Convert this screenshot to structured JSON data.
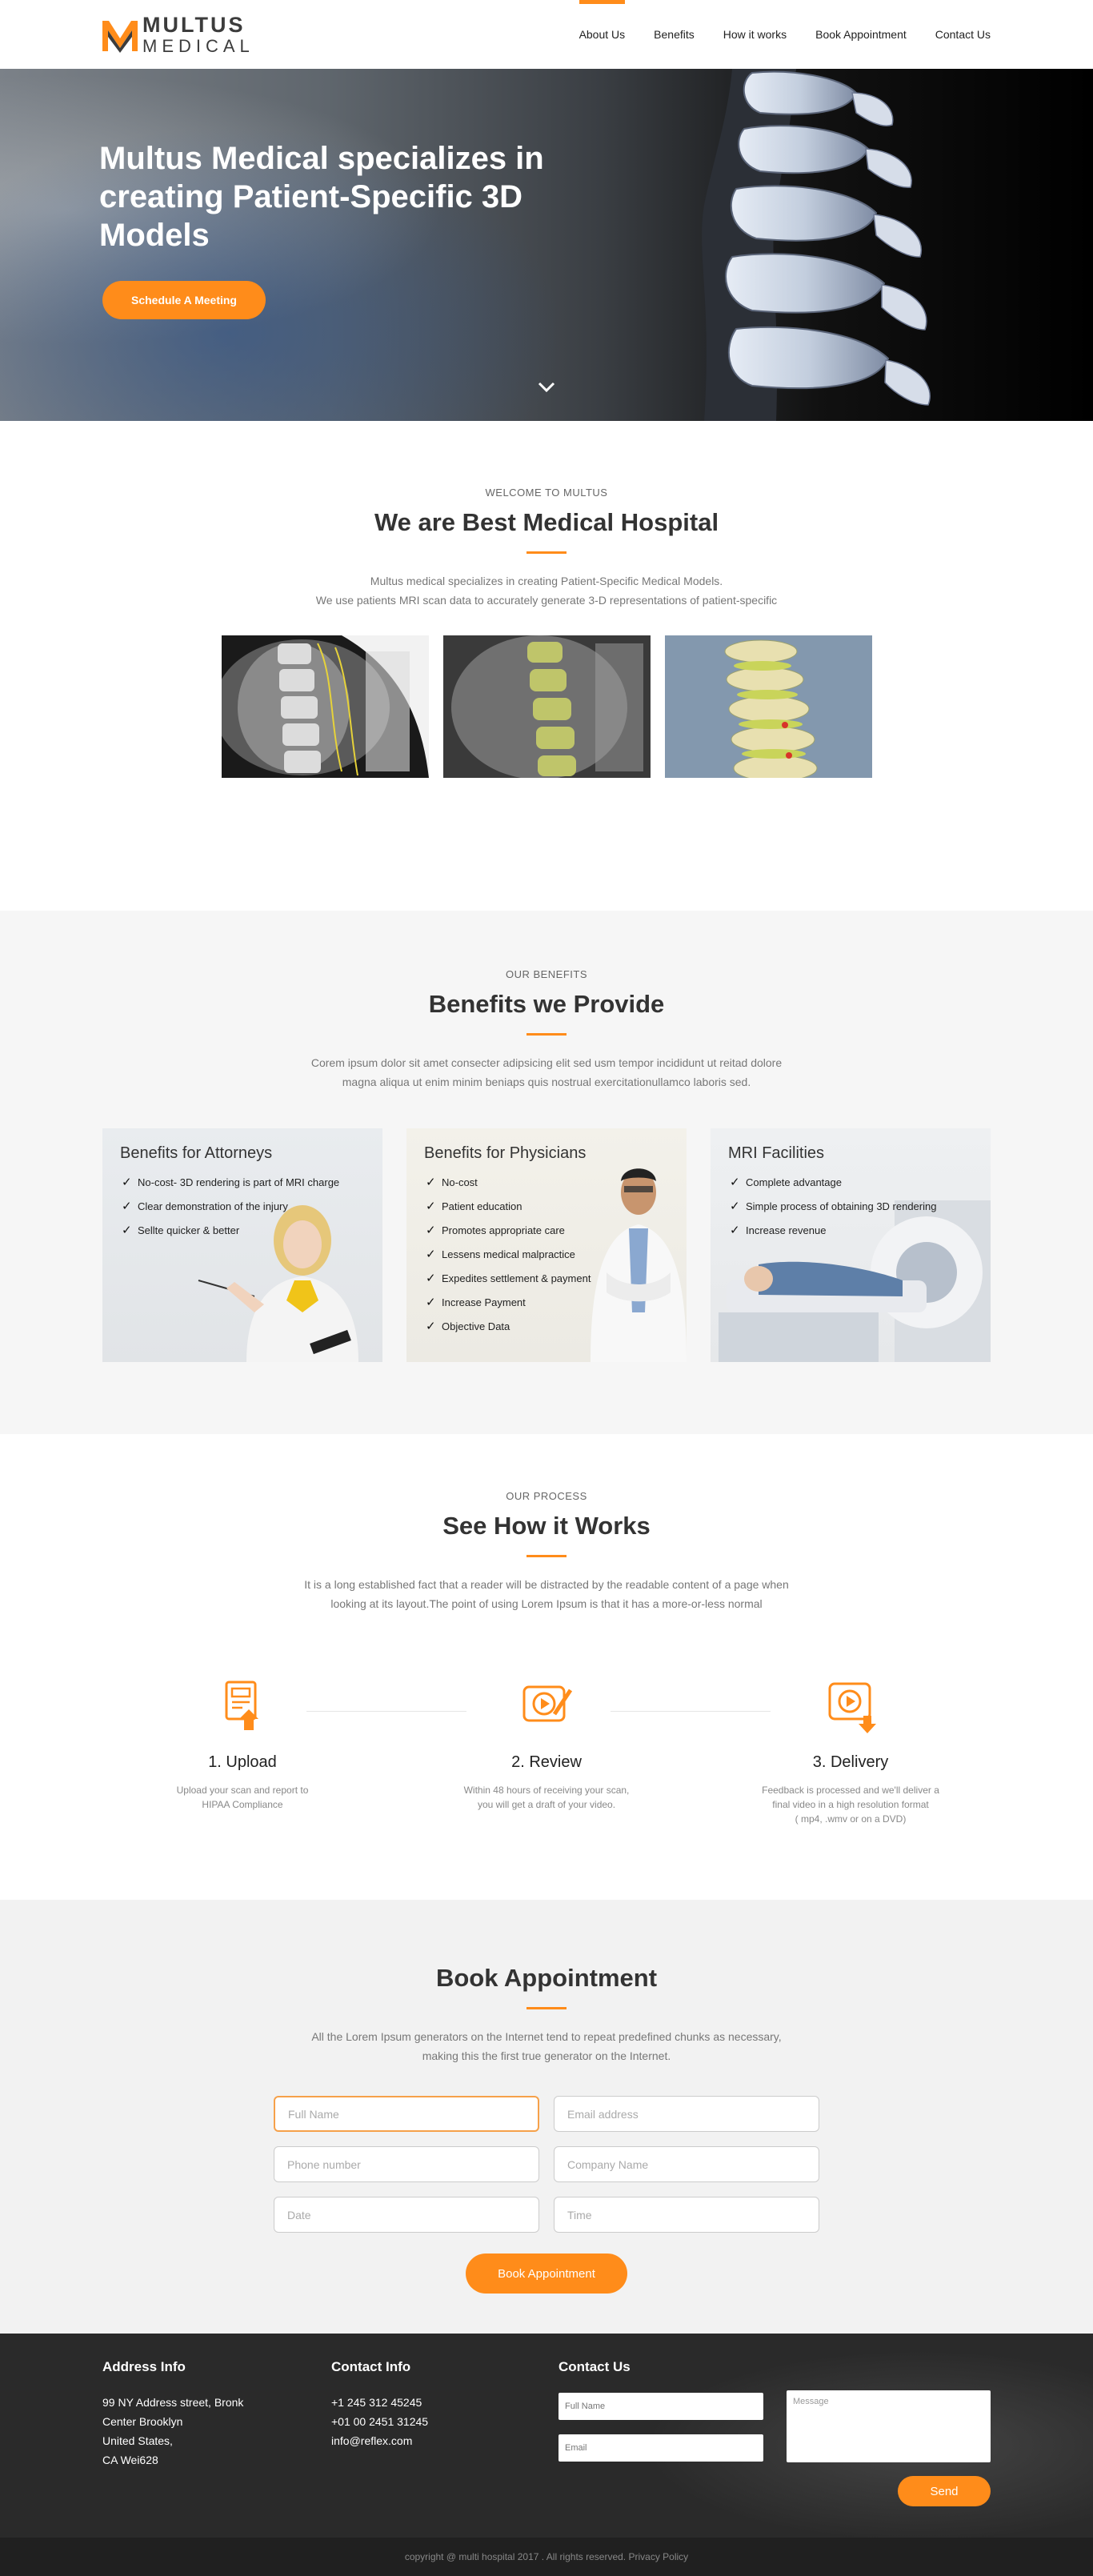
{
  "header": {
    "logo_line1": "MULTUS",
    "logo_line2": "MEDICAL",
    "nav": [
      "About Us",
      "Benefits",
      "How it works",
      "Book Appointment",
      "Contact Us"
    ]
  },
  "hero": {
    "title_bold": "Multus Medical",
    "title_rest": " specializes in creating Patient-Specific 3D Models",
    "button": "Schedule A Meeting"
  },
  "welcome": {
    "eyebrow": "WELCOME TO MULTUS",
    "title": "We are Best Medical Hospital",
    "text1": "Multus medical specializes in creating Patient-Specific Medical Models.",
    "text2": "We use patients MRI scan data to accurately generate 3-D representations of patient-specific"
  },
  "benefits": {
    "eyebrow": "OUR BENEFITS",
    "title": "Benefits we Provide",
    "text1": "Corem ipsum dolor sit amet consecter adipsicing elit sed usm tempor incididunt ut reitad dolore",
    "text2": "magna aliqua ut enim minim beniaps quis nostrual exercitationullamco laboris sed.",
    "cards": [
      {
        "title": "Benefits for Attorneys",
        "items": [
          "No-cost- 3D rendering is part of MRI charge",
          "Clear demonstration of the injury",
          "Sellte quicker & better"
        ]
      },
      {
        "title": "Benefits for Physicians",
        "items": [
          "No-cost",
          "Patient education",
          "Promotes appropriate care",
          "Lessens medical malpractice",
          "Expedites settlement & payment",
          "Increase Payment",
          "Objective Data"
        ]
      },
      {
        "title": "MRI Facilities",
        "items": [
          "Complete advantage",
          "Simple process of obtaining 3D rendering",
          "Increase revenue"
        ]
      }
    ]
  },
  "process": {
    "eyebrow": "OUR PROCESS",
    "title": "See How it Works",
    "text1": "It is a long established fact that a reader will be distracted by the readable content of a page when",
    "text2": "looking at its layout.The point of using Lorem Ipsum is that it has a more-or-less normal",
    "steps": [
      {
        "title": "1. Upload",
        "l1": "Upload your scan and report to",
        "l2": "HIPAA Compliance",
        "l3": ""
      },
      {
        "title": "2. Review",
        "l1": "Within 48 hours of receiving your scan,",
        "l2": "you will get a draft of your video.",
        "l3": ""
      },
      {
        "title": "3. Delivery",
        "l1": "Feedback is processed and we'll deliver a",
        "l2": "final video in a high resolution format",
        "l3": "( mp4, .wmv or on a DVD)"
      }
    ]
  },
  "booking": {
    "title": "Book Appointment",
    "text1": "All the Lorem Ipsum generators on the Internet tend to repeat predefined chunks as necessary,",
    "text2": "making this the first true generator on the Internet.",
    "placeholders": {
      "full_name": "Full Name",
      "email": "Email address",
      "phone": "Phone number",
      "company": "Company Name",
      "date": "Date",
      "time": "Time"
    },
    "button": "Book Appointment"
  },
  "footer": {
    "address_title": "Address Info",
    "address": [
      "99 NY Address street, Bronk",
      "Center Brooklyn",
      "United States,",
      "CA Wei628"
    ],
    "contact_title": "Contact Info",
    "contact": [
      "+1 245 312 45245",
      "+01 00 2451 31245",
      "info@reflex.com"
    ],
    "form_title": "Contact Us",
    "placeholders": {
      "name": "Full Name",
      "email": "Email",
      "message": "Message"
    },
    "send": "Send",
    "copyright": "copyright @ multi hospital 2017 . All rights reserved.",
    "privacy": "Privacy Policy"
  },
  "colors": {
    "accent": "#ff8c1a",
    "footer": "#2a2a2a",
    "section_alt": "#f6f6f6"
  }
}
